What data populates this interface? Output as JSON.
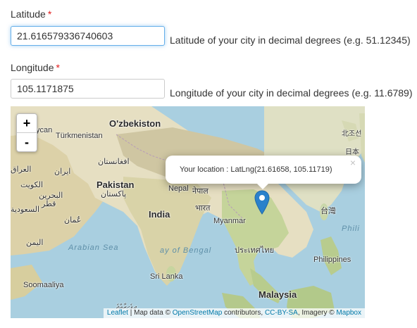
{
  "latitude": {
    "label": "Latitude",
    "required_mark": "*",
    "value": "21.616579336740603",
    "help": "Latitude of your city in decimal degrees (e.g. 51.12345)"
  },
  "longitude": {
    "label": "Longitude",
    "required_mark": "*",
    "value": "105.1171875",
    "help": "Longitude of your city in decimal degrees (e.g. 11.6789)"
  },
  "map": {
    "zoom_in": "+",
    "zoom_out": "-",
    "popup": {
      "text": "Your location : LatLng(21.61658, 105.11719)",
      "close": "×"
    },
    "labels": {
      "uzbekistan": "O'zbekiston",
      "turkmenistan": "Türkmenistan",
      "caspian": "ycan",
      "afghanistan": "افغانستان",
      "iran": "ایران",
      "iraq": "العراق",
      "kuwait": "الكويت",
      "bahrain": "البحرين",
      "qatar": "قطر",
      "saudi": "السعودية",
      "oman": "عُمان",
      "yemen": "اليمن",
      "pakistan": "Pakistan",
      "pakistan_ur": "پاکستان",
      "nepal": "Nepal",
      "nepal_local": "नेपाल",
      "bhutan": "भारत",
      "india": "India",
      "myanmar": "Myanmar",
      "arabian_sea": "Arabian Sea",
      "bay_of_bengal": "ay of Bengal",
      "thailand": "ประเทศไทย",
      "sri_lanka": "Sri Lanka",
      "malaysia": "Malaysia",
      "philippines": "Philippines",
      "phili": "Phili",
      "taiwan": "台灣",
      "korea": "北조선",
      "japan": "日本",
      "somalia": "Soomaaliya",
      "maldives": "ދިވެހިރާއްޖެ"
    },
    "attribution": {
      "leaflet": "Leaflet",
      "sep1": " | Map data © ",
      "osm": "OpenStreetMap",
      "sep2": " contributors, ",
      "license": "CC-BY-SA",
      "sep3": ", Imagery © ",
      "mapbox": "Mapbox"
    }
  },
  "colors": {
    "ocean": "#a9cfe0",
    "land": "#e8e1c6",
    "land_dark": "#c9c08f",
    "desert": "#d8c79c",
    "mountains": "#bdb28a",
    "marker": "#2a81cb",
    "required": "#e21b1b",
    "link": "#0078a8"
  }
}
